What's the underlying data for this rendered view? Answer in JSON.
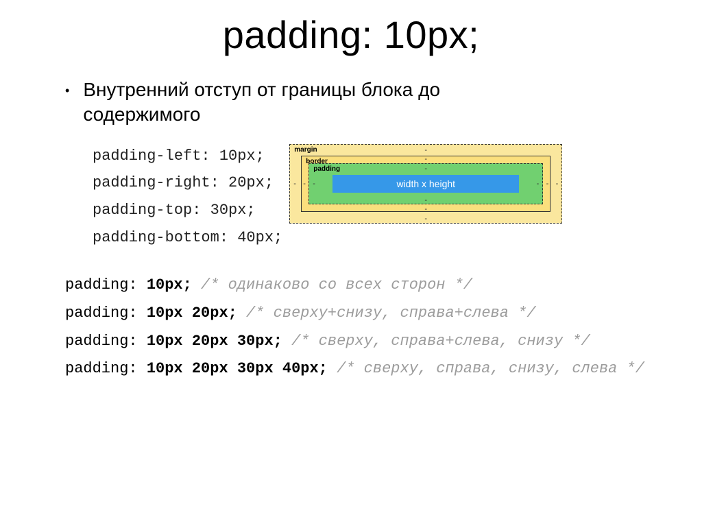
{
  "title": "padding: 10px;",
  "bullet_text": "Внутренний отступ от границы блока до содержимого",
  "code_lines": [
    "padding-left: 10px;",
    "padding-right: 20px;",
    "padding-top: 30px;",
    "padding-bottom: 40px;"
  ],
  "box_model": {
    "margin_label": "margin",
    "border_label": "border",
    "padding_label": "padding",
    "content_label": "width x height",
    "dash": "-"
  },
  "shorthand": [
    {
      "prop": "padding: ",
      "val": "10px;",
      "comment": " /* одинаково со всех сторон */"
    },
    {
      "prop": "padding: ",
      "val": "10px 20px;",
      "comment": " /* сверху+снизу, справа+слева */"
    },
    {
      "prop": "padding: ",
      "val": "10px 20px 30px;",
      "comment": " /* сверху, справа+слева, снизу */"
    },
    {
      "prop": "padding: ",
      "val": "10px 20px 30px 40px;",
      "comment": " /* сверху, справа, снизу, слева */"
    }
  ]
}
